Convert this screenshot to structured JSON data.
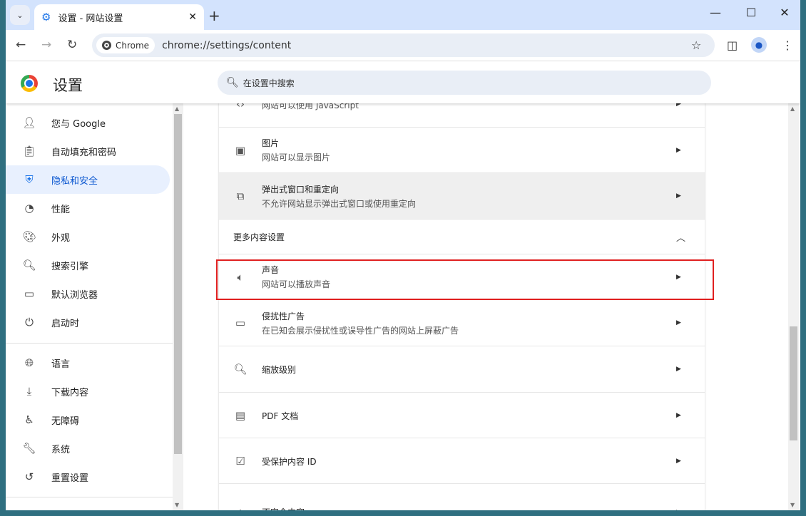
{
  "browser": {
    "tab_title": "设置 - 网站设置",
    "new_tab": "+",
    "chip_label": "Chrome",
    "url": "chrome://settings/content"
  },
  "header": {
    "title": "设置",
    "search_placeholder": "在设置中搜索"
  },
  "sidebar": {
    "items": [
      {
        "label": "您与 Google",
        "icon": "person-icon"
      },
      {
        "label": "自动填充和密码",
        "icon": "clipboard-icon"
      },
      {
        "label": "隐私和安全",
        "icon": "shield-icon",
        "active": true
      },
      {
        "label": "性能",
        "icon": "speedometer-icon"
      },
      {
        "label": "外观",
        "icon": "palette-icon"
      },
      {
        "label": "搜索引擎",
        "icon": "search-icon"
      },
      {
        "label": "默认浏览器",
        "icon": "browser-icon"
      },
      {
        "label": "启动时",
        "icon": "power-icon"
      },
      {
        "label": "语言",
        "icon": "globe-icon"
      },
      {
        "label": "下载内容",
        "icon": "download-icon"
      },
      {
        "label": "无障碍",
        "icon": "accessibility-icon"
      },
      {
        "label": "系统",
        "icon": "wrench-icon"
      },
      {
        "label": "重置设置",
        "icon": "restore-icon"
      }
    ]
  },
  "content": {
    "rows": [
      {
        "title": "",
        "subtitle": "网站可以使用 JavaScript",
        "icon": "code-icon"
      },
      {
        "title": "图片",
        "subtitle": "网站可以显示图片",
        "icon": "image-icon"
      },
      {
        "title": "弹出式窗口和重定向",
        "subtitle": "不允许网站显示弹出式窗口或使用重定向",
        "icon": "open-in-new-icon"
      }
    ],
    "section_label": "更多内容设置",
    "more_rows": [
      {
        "title": "声音",
        "subtitle": "网站可以播放声音",
        "icon": "volume-icon"
      },
      {
        "title": "侵扰性广告",
        "subtitle": "在已知会展示侵扰性或误导性广告的网站上屏蔽广告",
        "icon": "window-icon"
      },
      {
        "title": "缩放级别",
        "subtitle": "",
        "icon": "zoom-icon"
      },
      {
        "title": "PDF 文档",
        "subtitle": "",
        "icon": "pdf-icon"
      },
      {
        "title": "受保护内容 ID",
        "subtitle": "",
        "icon": "protected-content-icon"
      },
      {
        "title": "不安全内容",
        "subtitle": "",
        "icon": "warning-icon"
      }
    ]
  },
  "colors": {
    "accent": "#0b57d0",
    "highlight_box": "#e02020",
    "tabstrip": "#d3e3fd"
  }
}
